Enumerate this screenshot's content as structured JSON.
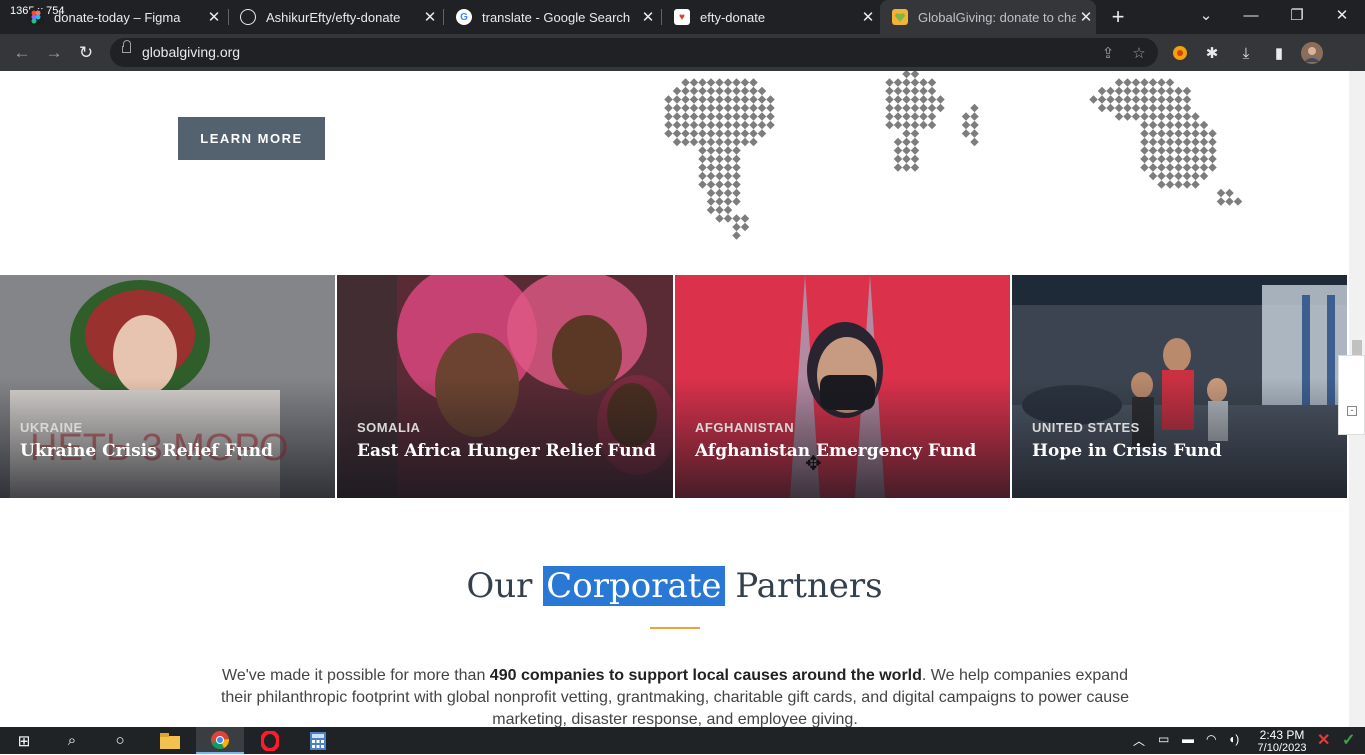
{
  "window": {
    "dimension_label": "1365 x 754",
    "controls": {
      "tab_search": "⌄",
      "minimize": "—",
      "restore": "❐",
      "close": "✕"
    }
  },
  "tabs": [
    {
      "title": "donate-today – Figma",
      "favicon": "figma-icon",
      "close": "✕",
      "active": false
    },
    {
      "title": "AshikurEfty/efty-donate",
      "favicon": "github-icon",
      "close": "✕",
      "active": false
    },
    {
      "title": "translate - Google Search",
      "favicon": "google-icon",
      "close": "✕",
      "active": false
    },
    {
      "title": "efty-donate",
      "favicon": "page-icon",
      "close": "✕",
      "active": false
    },
    {
      "title": "GlobalGiving: donate to char",
      "favicon": "globalgiving-icon",
      "close": "✕",
      "active": true
    }
  ],
  "new_tab": "+",
  "toolbar": {
    "url": "globalgiving.org",
    "back": "←",
    "forward": "→",
    "reload": "↻",
    "share": "⇪",
    "bookmark": "☆",
    "extensions": "✱",
    "download": "⤓",
    "sidepanel": "▮"
  },
  "page": {
    "learn_more": "LEARN MORE",
    "funds": [
      {
        "country": "UKRAINE",
        "title": "Ukraine Crisis Relief Fund",
        "bg": "#6f6f72",
        "accent": "#b4252f"
      },
      {
        "country": "SOMALIA",
        "title": "East Africa Hunger Relief Fund",
        "bg": "#5a2a35",
        "accent": "#d9477c"
      },
      {
        "country": "AFGHANISTAN",
        "title": "Afghanistan Emergency Fund",
        "bg": "#c8243a",
        "accent": "#e93b56"
      },
      {
        "country": "UNITED STATES",
        "title": "Hope in Crisis Fund",
        "bg": "#3b4450",
        "accent": "#6c7a8a"
      }
    ],
    "heading_before": "Our ",
    "heading_highlight": "Corporate",
    "heading_after": " Partners",
    "body_before": "We've made it possible for more than ",
    "body_bold": "490 companies to support local causes around the world",
    "body_after": ". We help companies expand their philanthropic footprint with global nonprofit vetting, grantmaking, charitable gift cards, and digital campaigns to power cause marketing, disaster response, and employee giving."
  },
  "taskbar": {
    "time": "2:43 PM",
    "date": "7/10/2023",
    "start": "⊞",
    "search": "⌕",
    "cortana": "○",
    "tray_up": "︿"
  },
  "colors": {
    "accent_button": "#54616f",
    "heading_rule": "#e8a33c",
    "highlight": "#2a78d6"
  }
}
